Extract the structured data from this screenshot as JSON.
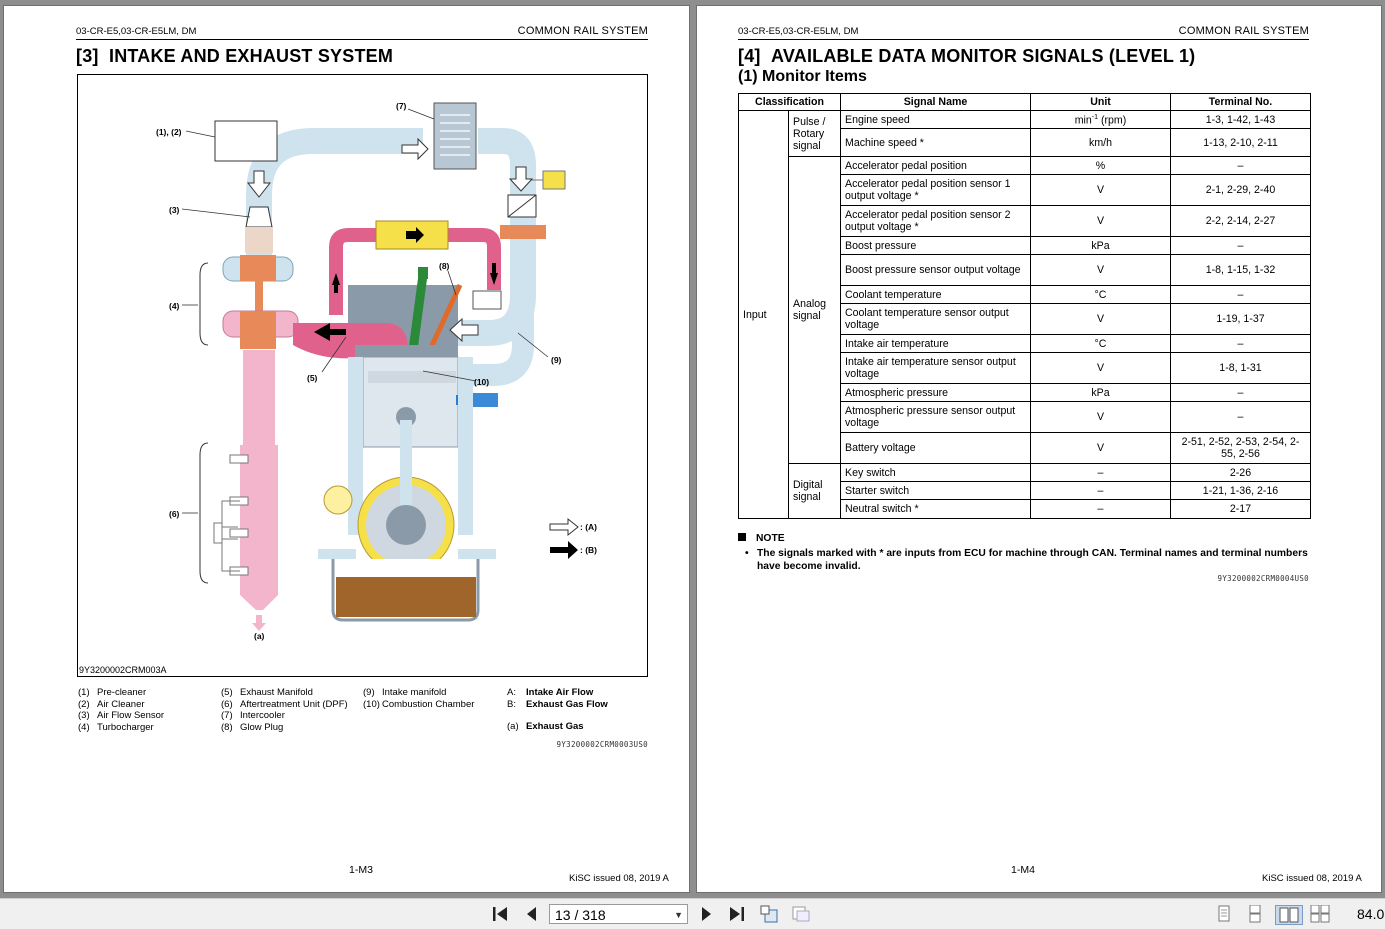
{
  "left_page": {
    "header_model": "03-CR-E5,03-CR-E5LM, DM",
    "header_system": "COMMON RAIL SYSTEM",
    "section_number": "[3]",
    "section_title": "INTAKE AND EXHAUST SYSTEM",
    "figure": {
      "callouts": {
        "c12": "(1), (2)",
        "c3": "(3)",
        "c4": "(4)",
        "c5": "(5)",
        "c6": "(6)",
        "c7": "(7)",
        "c8": "(8)",
        "c9": "(9)",
        "c10": "(10)",
        "ca": "(a)"
      },
      "key_a": ": (A)",
      "key_b": ": (B)",
      "code": "9Y3200002CRM003A"
    },
    "legend": {
      "col1": [
        {
          "num": "(1)",
          "label": "Pre-cleaner"
        },
        {
          "num": "(2)",
          "label": "Air Cleaner"
        },
        {
          "num": "(3)",
          "label": "Air Flow Sensor"
        },
        {
          "num": "(4)",
          "label": "Turbocharger"
        }
      ],
      "col2": [
        {
          "num": "(5)",
          "label": "Exhaust Manifold"
        },
        {
          "num": "(6)",
          "label": "Aftertreatment Unit (DPF)"
        },
        {
          "num": "(7)",
          "label": "Intercooler"
        },
        {
          "num": "(8)",
          "label": "Glow Plug"
        }
      ],
      "col3": [
        {
          "num": "(9)",
          "label": "Intake manifold"
        },
        {
          "num": "(10)",
          "label": "Combustion Chamber"
        }
      ],
      "col4": [
        {
          "num": "A:",
          "label": "Intake Air Flow"
        },
        {
          "num": "B:",
          "label": "Exhaust Gas Flow"
        },
        {
          "num": "(a)",
          "label": "Exhaust Gas"
        }
      ]
    },
    "doc_id": "9Y3200002CRM0003US0",
    "page_number": "1-M3",
    "issued": "KiSC issued 08, 2019 A"
  },
  "right_page": {
    "header_model": "03-CR-E5,03-CR-E5LM, DM",
    "header_system": "COMMON RAIL SYSTEM",
    "section_number": "[4]",
    "section_title": "AVAILABLE DATA MONITOR SIGNALS (LEVEL 1)",
    "subsection": "(1)   Monitor Items",
    "table": {
      "headers": [
        "Classification",
        "Signal Name",
        "Unit",
        "Terminal No."
      ],
      "classification": "Input",
      "groups": {
        "pulse": "Pulse / Rotary signal",
        "analog": "Analog signal",
        "digital": "Digital signal"
      },
      "rows": [
        {
          "signal": "Engine speed",
          "unit": "min-1 (rpm)",
          "terminal": "1-3, 1-42, 1-43"
        },
        {
          "signal": "Machine speed *",
          "unit": "km/h",
          "terminal": "1-13, 2-10, 2-11"
        },
        {
          "signal": "Accelerator pedal position",
          "unit": "%",
          "terminal": "–"
        },
        {
          "signal": "Accelerator pedal position sensor 1 output voltage *",
          "unit": "V",
          "terminal": "2-1, 2-29, 2-40"
        },
        {
          "signal": "Accelerator pedal position sensor 2 output voltage *",
          "unit": "V",
          "terminal": "2-2, 2-14, 2-27"
        },
        {
          "signal": "Boost pressure",
          "unit": "kPa",
          "terminal": "–"
        },
        {
          "signal": "Boost pressure sensor output voltage",
          "unit": "V",
          "terminal": "1-8, 1-15, 1-32"
        },
        {
          "signal": "Coolant temperature",
          "unit": "°C",
          "terminal": "–"
        },
        {
          "signal": "Coolant temperature sensor output voltage",
          "unit": "V",
          "terminal": "1-19, 1-37"
        },
        {
          "signal": "Intake air temperature",
          "unit": "°C",
          "terminal": "–"
        },
        {
          "signal": "Intake air temperature sensor output voltage",
          "unit": "V",
          "terminal": "1-8, 1-31"
        },
        {
          "signal": "Atmospheric pressure",
          "unit": "kPa",
          "terminal": "–"
        },
        {
          "signal": "Atmospheric pressure sensor output voltage",
          "unit": "V",
          "terminal": "–"
        },
        {
          "signal": "Battery voltage",
          "unit": "V",
          "terminal": "2-51, 2-52, 2-53, 2-54, 2-55, 2-56"
        },
        {
          "signal": "Key switch",
          "unit": "–",
          "terminal": "2-26"
        },
        {
          "signal": "Starter switch",
          "unit": "–",
          "terminal": "1-21, 1-36, 2-16"
        },
        {
          "signal": "Neutral switch *",
          "unit": "–",
          "terminal": "2-17"
        }
      ]
    },
    "note_title": "NOTE",
    "note_text": "The signals marked with * are inputs from ECU for machine through CAN. Terminal names and terminal numbers have become invalid.",
    "doc_id": "9Y3200002CRM0004US0",
    "page_number": "1-M4",
    "issued": "KiSC issued 08, 2019 A"
  },
  "toolbar": {
    "page_field": "13 / 318",
    "zoom": "84.0",
    "icons": [
      "first-page-icon",
      "prev-page-icon",
      "next-page-icon",
      "last-page-icon",
      "rotate-icon",
      "snapshot-icon",
      "single-page-view-icon",
      "continuous-view-icon",
      "two-page-view-icon",
      "two-page-continuous-view-icon"
    ]
  },
  "colors": {
    "intake_air": "#cfe3ee",
    "exhaust": "#e0628c",
    "exhaust_light": "#f2b5cc",
    "turbo": "#e8895a",
    "oil": "#a0652a",
    "intercooler": "#f5e04a"
  }
}
